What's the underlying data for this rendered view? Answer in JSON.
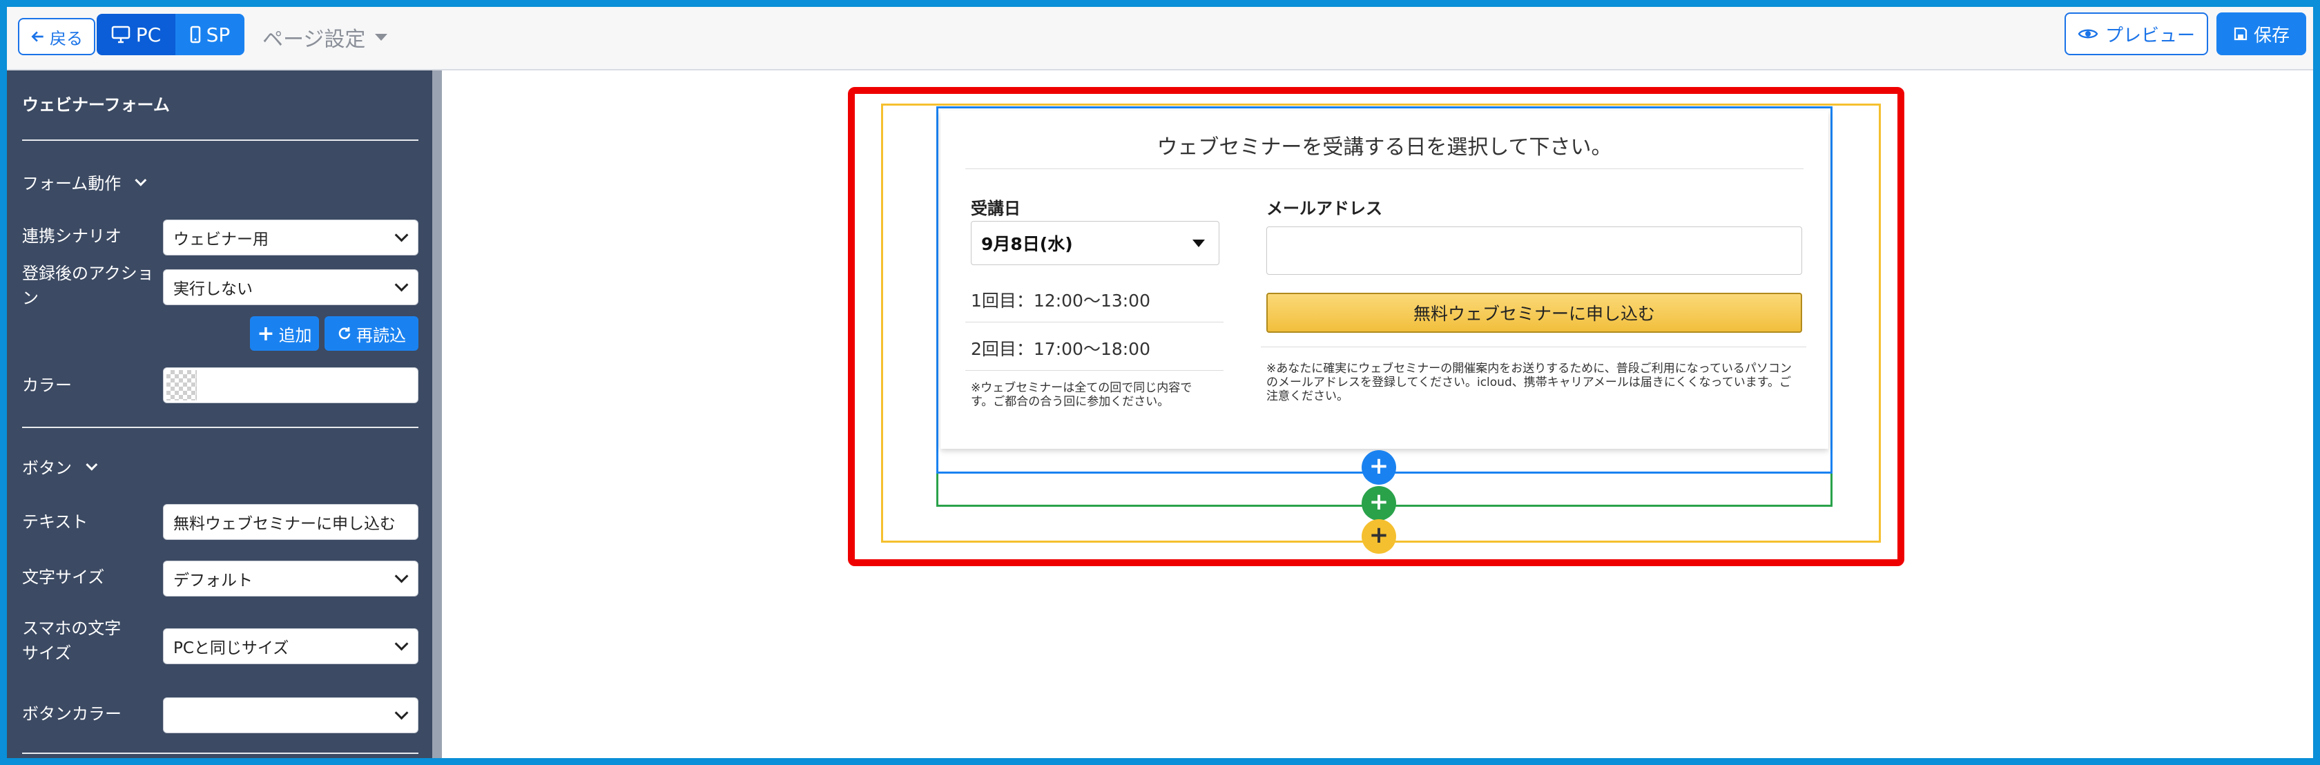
{
  "topbar": {
    "back_label": "戻る",
    "device_pc": "PC",
    "device_sp": "SP",
    "page_settings": "ページ設定",
    "preview_label": "プレビュー",
    "save_label": "保存"
  },
  "sidebar": {
    "title": "ウェビナーフォーム",
    "section_form_action": "フォーム動作",
    "scenario_label": "連携シナリオ",
    "scenario_value": "ウェビナー用",
    "after_action_label": "登録後のアクション",
    "after_action_value": "実行しない",
    "add_label": "追加",
    "reload_label": "再読込",
    "color_label": "カラー",
    "section_button": "ボタン",
    "text_label": "テキスト",
    "text_value": "無料ウェブセミナーに申し込む",
    "font_size_label": "文字サイズ",
    "font_size_value": "デフォルト",
    "sp_font_size_label": "スマホの文字サイズ",
    "sp_font_size_value": "PCと同じサイズ",
    "button_color_label": "ボタンカラー",
    "button_color_value": ""
  },
  "form": {
    "title": "ウェブセミナーを受講する日を選択して下さい。",
    "date_label": "受講日",
    "date_value": "9月8日(水)",
    "session1": "1回目：12:00〜13:00",
    "session2": "2回目：17:00〜18:00",
    "session_note": "※ウェブセミナーは全ての回で同じ内容です。ご都合の合う回に参加ください。",
    "email_label": "メールアドレス",
    "email_value": "",
    "submit_label": "無料ウェブセミナーに申し込む",
    "email_note": "※あなたに確実にウェブセミナーの開催案内をお送りするために、普段ご利用になっているパソコンのメールアドレスを登録してください。icloud、携帯キャリアメールは届きにくくなっています。ご注意ください。"
  },
  "canvas": {
    "add_symbol": "+"
  },
  "colors": {
    "accent_blue": "#1a82f0",
    "highlight_red": "#ef0000",
    "frame_yellow": "#f5c02f",
    "frame_green": "#2aa24a",
    "sidebar_bg": "#3c4a63"
  }
}
